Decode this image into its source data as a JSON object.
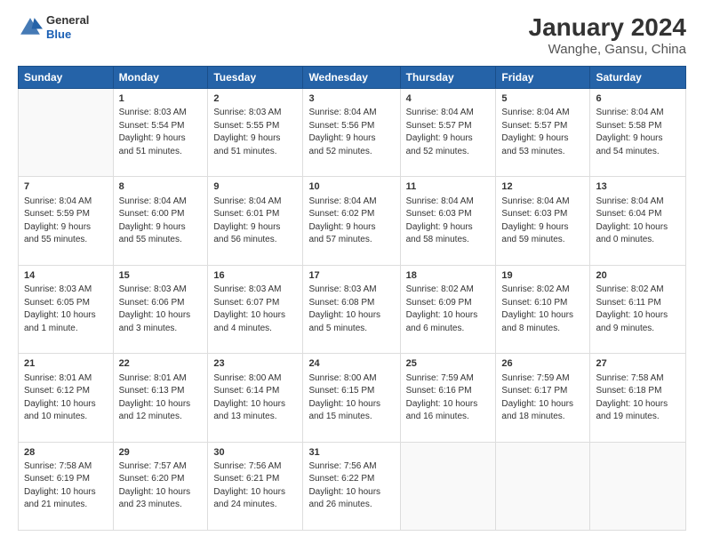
{
  "header": {
    "logo_line1": "General",
    "logo_line2": "Blue",
    "main_title": "January 2024",
    "subtitle": "Wanghe, Gansu, China"
  },
  "calendar": {
    "days_header": [
      "Sunday",
      "Monday",
      "Tuesday",
      "Wednesday",
      "Thursday",
      "Friday",
      "Saturday"
    ],
    "weeks": [
      [
        {
          "day": "",
          "info": ""
        },
        {
          "day": "1",
          "info": "Sunrise: 8:03 AM\nSunset: 5:54 PM\nDaylight: 9 hours\nand 51 minutes."
        },
        {
          "day": "2",
          "info": "Sunrise: 8:03 AM\nSunset: 5:55 PM\nDaylight: 9 hours\nand 51 minutes."
        },
        {
          "day": "3",
          "info": "Sunrise: 8:04 AM\nSunset: 5:56 PM\nDaylight: 9 hours\nand 52 minutes."
        },
        {
          "day": "4",
          "info": "Sunrise: 8:04 AM\nSunset: 5:57 PM\nDaylight: 9 hours\nand 52 minutes."
        },
        {
          "day": "5",
          "info": "Sunrise: 8:04 AM\nSunset: 5:57 PM\nDaylight: 9 hours\nand 53 minutes."
        },
        {
          "day": "6",
          "info": "Sunrise: 8:04 AM\nSunset: 5:58 PM\nDaylight: 9 hours\nand 54 minutes."
        }
      ],
      [
        {
          "day": "7",
          "info": "Sunrise: 8:04 AM\nSunset: 5:59 PM\nDaylight: 9 hours\nand 55 minutes."
        },
        {
          "day": "8",
          "info": "Sunrise: 8:04 AM\nSunset: 6:00 PM\nDaylight: 9 hours\nand 55 minutes."
        },
        {
          "day": "9",
          "info": "Sunrise: 8:04 AM\nSunset: 6:01 PM\nDaylight: 9 hours\nand 56 minutes."
        },
        {
          "day": "10",
          "info": "Sunrise: 8:04 AM\nSunset: 6:02 PM\nDaylight: 9 hours\nand 57 minutes."
        },
        {
          "day": "11",
          "info": "Sunrise: 8:04 AM\nSunset: 6:03 PM\nDaylight: 9 hours\nand 58 minutes."
        },
        {
          "day": "12",
          "info": "Sunrise: 8:04 AM\nSunset: 6:03 PM\nDaylight: 9 hours\nand 59 minutes."
        },
        {
          "day": "13",
          "info": "Sunrise: 8:04 AM\nSunset: 6:04 PM\nDaylight: 10 hours\nand 0 minutes."
        }
      ],
      [
        {
          "day": "14",
          "info": "Sunrise: 8:03 AM\nSunset: 6:05 PM\nDaylight: 10 hours\nand 1 minute."
        },
        {
          "day": "15",
          "info": "Sunrise: 8:03 AM\nSunset: 6:06 PM\nDaylight: 10 hours\nand 3 minutes."
        },
        {
          "day": "16",
          "info": "Sunrise: 8:03 AM\nSunset: 6:07 PM\nDaylight: 10 hours\nand 4 minutes."
        },
        {
          "day": "17",
          "info": "Sunrise: 8:03 AM\nSunset: 6:08 PM\nDaylight: 10 hours\nand 5 minutes."
        },
        {
          "day": "18",
          "info": "Sunrise: 8:02 AM\nSunset: 6:09 PM\nDaylight: 10 hours\nand 6 minutes."
        },
        {
          "day": "19",
          "info": "Sunrise: 8:02 AM\nSunset: 6:10 PM\nDaylight: 10 hours\nand 8 minutes."
        },
        {
          "day": "20",
          "info": "Sunrise: 8:02 AM\nSunset: 6:11 PM\nDaylight: 10 hours\nand 9 minutes."
        }
      ],
      [
        {
          "day": "21",
          "info": "Sunrise: 8:01 AM\nSunset: 6:12 PM\nDaylight: 10 hours\nand 10 minutes."
        },
        {
          "day": "22",
          "info": "Sunrise: 8:01 AM\nSunset: 6:13 PM\nDaylight: 10 hours\nand 12 minutes."
        },
        {
          "day": "23",
          "info": "Sunrise: 8:00 AM\nSunset: 6:14 PM\nDaylight: 10 hours\nand 13 minutes."
        },
        {
          "day": "24",
          "info": "Sunrise: 8:00 AM\nSunset: 6:15 PM\nDaylight: 10 hours\nand 15 minutes."
        },
        {
          "day": "25",
          "info": "Sunrise: 7:59 AM\nSunset: 6:16 PM\nDaylight: 10 hours\nand 16 minutes."
        },
        {
          "day": "26",
          "info": "Sunrise: 7:59 AM\nSunset: 6:17 PM\nDaylight: 10 hours\nand 18 minutes."
        },
        {
          "day": "27",
          "info": "Sunrise: 7:58 AM\nSunset: 6:18 PM\nDaylight: 10 hours\nand 19 minutes."
        }
      ],
      [
        {
          "day": "28",
          "info": "Sunrise: 7:58 AM\nSunset: 6:19 PM\nDaylight: 10 hours\nand 21 minutes."
        },
        {
          "day": "29",
          "info": "Sunrise: 7:57 AM\nSunset: 6:20 PM\nDaylight: 10 hours\nand 23 minutes."
        },
        {
          "day": "30",
          "info": "Sunrise: 7:56 AM\nSunset: 6:21 PM\nDaylight: 10 hours\nand 24 minutes."
        },
        {
          "day": "31",
          "info": "Sunrise: 7:56 AM\nSunset: 6:22 PM\nDaylight: 10 hours\nand 26 minutes."
        },
        {
          "day": "",
          "info": ""
        },
        {
          "day": "",
          "info": ""
        },
        {
          "day": "",
          "info": ""
        }
      ]
    ]
  }
}
